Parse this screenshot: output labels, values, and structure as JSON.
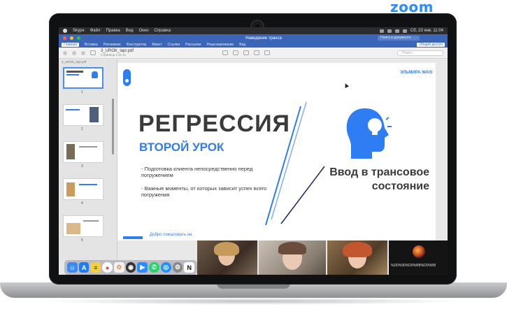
{
  "overlay": {
    "logo": "zoom"
  },
  "menubar": {
    "app": "Skype",
    "items": [
      "Файл",
      "Правка",
      "Вид",
      "Окно",
      "Справка"
    ],
    "clock": "Сб, 23 янв. 11:04"
  },
  "word": {
    "doc_title": "Наведение транса",
    "search_placeholder": "Поиск в документе",
    "share_label": "Общий доступ",
    "tabs": [
      "Главная",
      "Вставка",
      "Рисование",
      "Конструктор",
      "Макет",
      "Ссылки",
      "Рассылки",
      "Рецензирование",
      "Вид"
    ]
  },
  "preview": {
    "filename": "3_UROK_lapr.pdf",
    "page_info": "Страница 1 из 11",
    "search_placeholder": "Поиск"
  },
  "sidebar": {
    "file_label": "3_UROK_lapr.pdf",
    "thumbs": [
      "1",
      "2",
      "3",
      "4",
      "5"
    ]
  },
  "slide": {
    "author": "ЭЛЬМИРА WAIS",
    "title_main": "РЕГРЕССИЯ",
    "title_sub": "ВТОРОЙ УРОК",
    "bullets": [
      "- Подготовка клиента непосредственно перед погружением",
      "- Важные моменты, от которых зависит успех всего погружения"
    ],
    "intro_line1": "Ввод в трансовое",
    "intro_line2": "состояние",
    "next_caption": "Добро пожаловать на",
    "colors": {
      "accent": "#2f7df3",
      "title": "#3a3a3a"
    }
  },
  "video": {
    "tile4_name": "%D0%90%D0%BB%D0%B8"
  },
  "dock": {
    "icons": [
      "finder-icon",
      "app-store-icon",
      "notes-icon",
      "chrome-icon",
      "photos-icon",
      "obs-icon",
      "zoom-icon",
      "whatsapp-icon",
      "safari-icon",
      "settings-icon",
      "notion-icon"
    ]
  }
}
